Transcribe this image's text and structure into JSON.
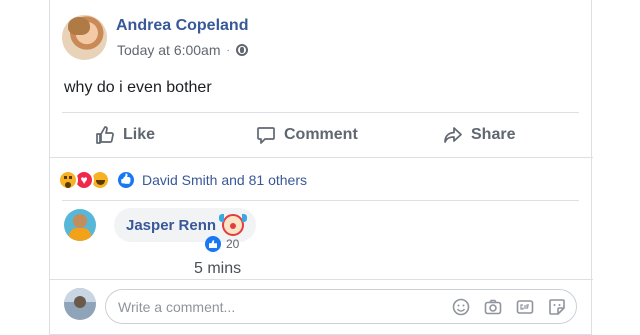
{
  "post": {
    "author": "Andrea Copeland",
    "timestamp": "Today at 6:00am",
    "separator": "·",
    "text": "why do i even bother"
  },
  "actions": {
    "like": "Like",
    "comment": "Comment",
    "share": "Share"
  },
  "reactions": {
    "types": [
      "wow",
      "love",
      "haha",
      "like"
    ],
    "summary": "David Smith and 81 others"
  },
  "comment": {
    "author": "Jasper Renn",
    "emoji": "clown-face",
    "likes": "20",
    "time": "5 mins"
  },
  "composer": {
    "placeholder": "Write a comment..."
  },
  "colors": {
    "link": "#385898",
    "muted": "#616770",
    "like_blue": "#1877f2",
    "divider": "#dddfe2"
  }
}
